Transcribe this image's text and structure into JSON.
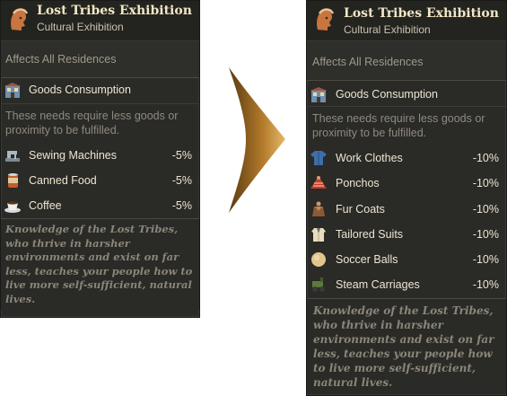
{
  "before": {
    "title": "Lost Tribes Exhibition",
    "subtitle": "Cultural Exhibition",
    "affects": "Affects All Residences",
    "goods_label": "Goods Consumption",
    "description": "These needs require less goods or proximity to be fulfilled.",
    "items": [
      {
        "icon": "sewing-machine-icon",
        "name": "Sewing Machines",
        "value": "-5%"
      },
      {
        "icon": "canned-food-icon",
        "name": "Canned Food",
        "value": "-5%"
      },
      {
        "icon": "coffee-icon",
        "name": "Coffee",
        "value": "-5%"
      }
    ],
    "lore": "Knowledge of the Lost Tribes, who thrive in harsher environments and exist on far less, teaches your people how to live more self-sufficient, natural lives."
  },
  "after": {
    "title": "Lost Tribes Exhibition",
    "subtitle": "Cultural Exhibition",
    "affects": "Affects All Residences",
    "goods_label": "Goods Consumption",
    "description": "These needs require less goods or proximity to be fulfilled.",
    "items": [
      {
        "icon": "work-clothes-icon",
        "name": "Work Clothes",
        "value": "-10%"
      },
      {
        "icon": "ponchos-icon",
        "name": "Ponchos",
        "value": "-10%"
      },
      {
        "icon": "fur-coats-icon",
        "name": "Fur Coats",
        "value": "-10%"
      },
      {
        "icon": "tailored-suits-icon",
        "name": "Tailored Suits",
        "value": "-10%"
      },
      {
        "icon": "soccer-balls-icon",
        "name": "Soccer Balls",
        "value": "-10%"
      },
      {
        "icon": "steam-carriages-icon",
        "name": "Steam Carriages",
        "value": "-10%"
      }
    ],
    "lore": "Knowledge of the Lost Tribes, who thrive in harsher environments and exist on far less, teaches your people how to live more self-sufficient, natural lives."
  },
  "colors": {
    "panel_bg": "#2a2a27",
    "title": "#f2e7c5",
    "muted": "#9e998c",
    "arrow": "#a06a1e"
  }
}
